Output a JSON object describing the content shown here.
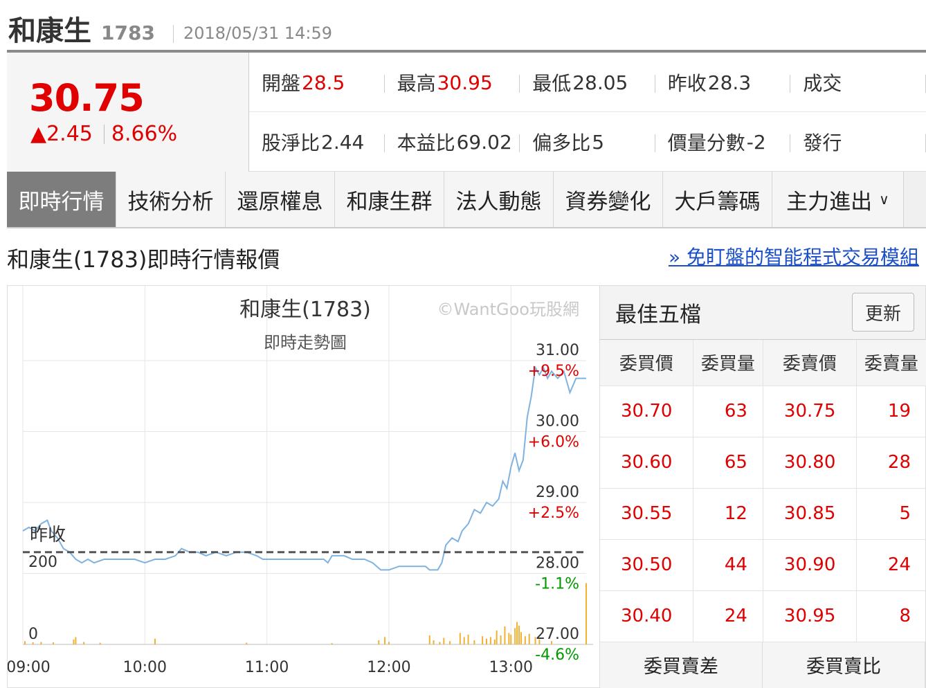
{
  "header": {
    "name": "和康生",
    "code": "1783",
    "datetime": "2018/05/31 14:59"
  },
  "quote": {
    "price": "30.75",
    "change": "▲2.45",
    "change_pct": "8.66%",
    "row1": [
      {
        "label": "開盤",
        "value": "28.5",
        "color": "red"
      },
      {
        "label": "最高",
        "value": "30.95",
        "color": "red"
      },
      {
        "label": "最低",
        "value": "28.05",
        "color": "normal"
      },
      {
        "label": "昨收",
        "value": "28.3",
        "color": "normal"
      },
      {
        "label": "成交",
        "value": "",
        "color": "normal"
      }
    ],
    "row2": [
      {
        "label": "股淨比",
        "value": "2.44"
      },
      {
        "label": "本益比",
        "value": "69.02"
      },
      {
        "label": "偏多比",
        "value": "5"
      },
      {
        "label": "價量分數",
        "value": "-2"
      },
      {
        "label": "發行",
        "value": ""
      }
    ]
  },
  "tabs": [
    "即時行情",
    "技術分析",
    "還原權息",
    "和康生群",
    "法人動態",
    "資券變化",
    "大戶籌碼",
    "主力進出"
  ],
  "section": {
    "title": "和康生(1783)即時行情報價",
    "link": "» 免盯盤的智能程式交易模組"
  },
  "chart_data": {
    "type": "line",
    "title": "和康生(1783)",
    "subtitle": "即時走勢圖",
    "watermark": "©WantGoo玩股網",
    "x_ticks": [
      "09:00",
      "10:00",
      "11:00",
      "12:00",
      "13:00"
    ],
    "y_ticks": [
      {
        "price": 31.0,
        "pct": "+9.5%"
      },
      {
        "price": 30.0,
        "pct": "+6.0%"
      },
      {
        "price": 29.0,
        "pct": "+2.5%"
      },
      {
        "price": 28.0,
        "pct": "-1.1%"
      },
      {
        "price": 27.0,
        "pct": "-4.6%"
      }
    ],
    "y_tick_labels": [
      "31.00",
      "30.00",
      "29.00",
      "28.00",
      "27.00"
    ],
    "ylim": [
      27.0,
      31.0
    ],
    "prev_close": 28.3,
    "prev_close_label": "昨收",
    "volume_ticks": [
      "200",
      "0"
    ],
    "line_color": "#7fb2e0",
    "volume_color": "#f0b030",
    "price_series": [
      [
        0,
        28.6
      ],
      [
        3,
        28.65
      ],
      [
        6,
        28.6
      ],
      [
        9,
        28.7
      ],
      [
        12,
        28.75
      ],
      [
        14,
        28.6
      ],
      [
        17,
        28.5
      ],
      [
        20,
        28.35
      ],
      [
        23,
        28.3
      ],
      [
        26,
        28.2
      ],
      [
        29,
        28.15
      ],
      [
        32,
        28.2
      ],
      [
        35,
        28.15
      ],
      [
        40,
        28.2
      ],
      [
        45,
        28.2
      ],
      [
        50,
        28.2
      ],
      [
        55,
        28.2
      ],
      [
        60,
        28.15
      ],
      [
        65,
        28.2
      ],
      [
        70,
        28.2
      ],
      [
        75,
        28.25
      ],
      [
        78,
        28.35
      ],
      [
        82,
        28.3
      ],
      [
        86,
        28.3
      ],
      [
        90,
        28.25
      ],
      [
        95,
        28.3
      ],
      [
        100,
        28.25
      ],
      [
        105,
        28.3
      ],
      [
        110,
        28.3
      ],
      [
        115,
        28.25
      ],
      [
        118,
        28.2
      ],
      [
        122,
        28.2
      ],
      [
        130,
        28.2
      ],
      [
        140,
        28.2
      ],
      [
        148,
        28.2
      ],
      [
        150,
        28.15
      ],
      [
        152,
        28.25
      ],
      [
        158,
        28.25
      ],
      [
        162,
        28.2
      ],
      [
        168,
        28.2
      ],
      [
        172,
        28.15
      ],
      [
        176,
        28.05
      ],
      [
        180,
        28.05
      ],
      [
        185,
        28.1
      ],
      [
        190,
        28.1
      ],
      [
        198,
        28.1
      ],
      [
        200,
        28.05
      ],
      [
        204,
        28.05
      ],
      [
        206,
        28.15
      ],
      [
        208,
        28.4
      ],
      [
        211,
        28.5
      ],
      [
        214,
        28.45
      ],
      [
        216,
        28.6
      ],
      [
        219,
        28.7
      ],
      [
        222,
        28.9
      ],
      [
        225,
        28.85
      ],
      [
        228,
        29.0
      ],
      [
        231,
        28.95
      ],
      [
        234,
        29.05
      ],
      [
        236,
        29.3
      ],
      [
        238,
        29.2
      ],
      [
        240,
        29.5
      ],
      [
        242,
        29.7
      ],
      [
        244,
        29.45
      ],
      [
        246,
        29.6
      ],
      [
        248,
        30.2
      ],
      [
        250,
        30.5
      ],
      [
        252,
        30.9
      ],
      [
        254,
        30.8
      ],
      [
        256,
        30.9
      ],
      [
        258,
        30.75
      ],
      [
        260,
        30.85
      ],
      [
        263,
        30.75
      ],
      [
        266,
        30.85
      ],
      [
        269,
        30.55
      ],
      [
        272,
        30.75
      ],
      [
        275,
        30.75
      ],
      [
        277,
        30.75
      ]
    ],
    "volume_series": [
      [
        1,
        8
      ],
      [
        5,
        5
      ],
      [
        9,
        6
      ],
      [
        15,
        5
      ],
      [
        25,
        12
      ],
      [
        26,
        18
      ],
      [
        30,
        6
      ],
      [
        38,
        4
      ],
      [
        65,
        14
      ],
      [
        110,
        4
      ],
      [
        152,
        3
      ],
      [
        175,
        10
      ],
      [
        178,
        18
      ],
      [
        180,
        6
      ],
      [
        200,
        22
      ],
      [
        202,
        10
      ],
      [
        205,
        6
      ],
      [
        207,
        16
      ],
      [
        210,
        8
      ],
      [
        215,
        28
      ],
      [
        217,
        18
      ],
      [
        219,
        24
      ],
      [
        222,
        10
      ],
      [
        226,
        20
      ],
      [
        228,
        14
      ],
      [
        230,
        18
      ],
      [
        232,
        12
      ],
      [
        233,
        34
      ],
      [
        235,
        22
      ],
      [
        237,
        44
      ],
      [
        239,
        28
      ],
      [
        240,
        24
      ],
      [
        242,
        40
      ],
      [
        243,
        55
      ],
      [
        244,
        46
      ],
      [
        245,
        30
      ],
      [
        247,
        20
      ],
      [
        249,
        26
      ],
      [
        252,
        18
      ],
      [
        254,
        12
      ],
      [
        260,
        8
      ],
      [
        277,
        150
      ]
    ]
  },
  "best5": {
    "title": "最佳五檔",
    "refresh": "更新",
    "headers": [
      "委買價",
      "委買量",
      "委賣價",
      "委賣量"
    ],
    "rows": [
      [
        "30.70",
        "63",
        "30.75",
        "19"
      ],
      [
        "30.60",
        "65",
        "30.80",
        "28"
      ],
      [
        "30.55",
        "12",
        "30.85",
        "5"
      ],
      [
        "30.50",
        "44",
        "30.90",
        "24"
      ],
      [
        "30.40",
        "24",
        "30.95",
        "8"
      ]
    ],
    "footer": [
      "委買賣差",
      "委買賣比"
    ]
  }
}
